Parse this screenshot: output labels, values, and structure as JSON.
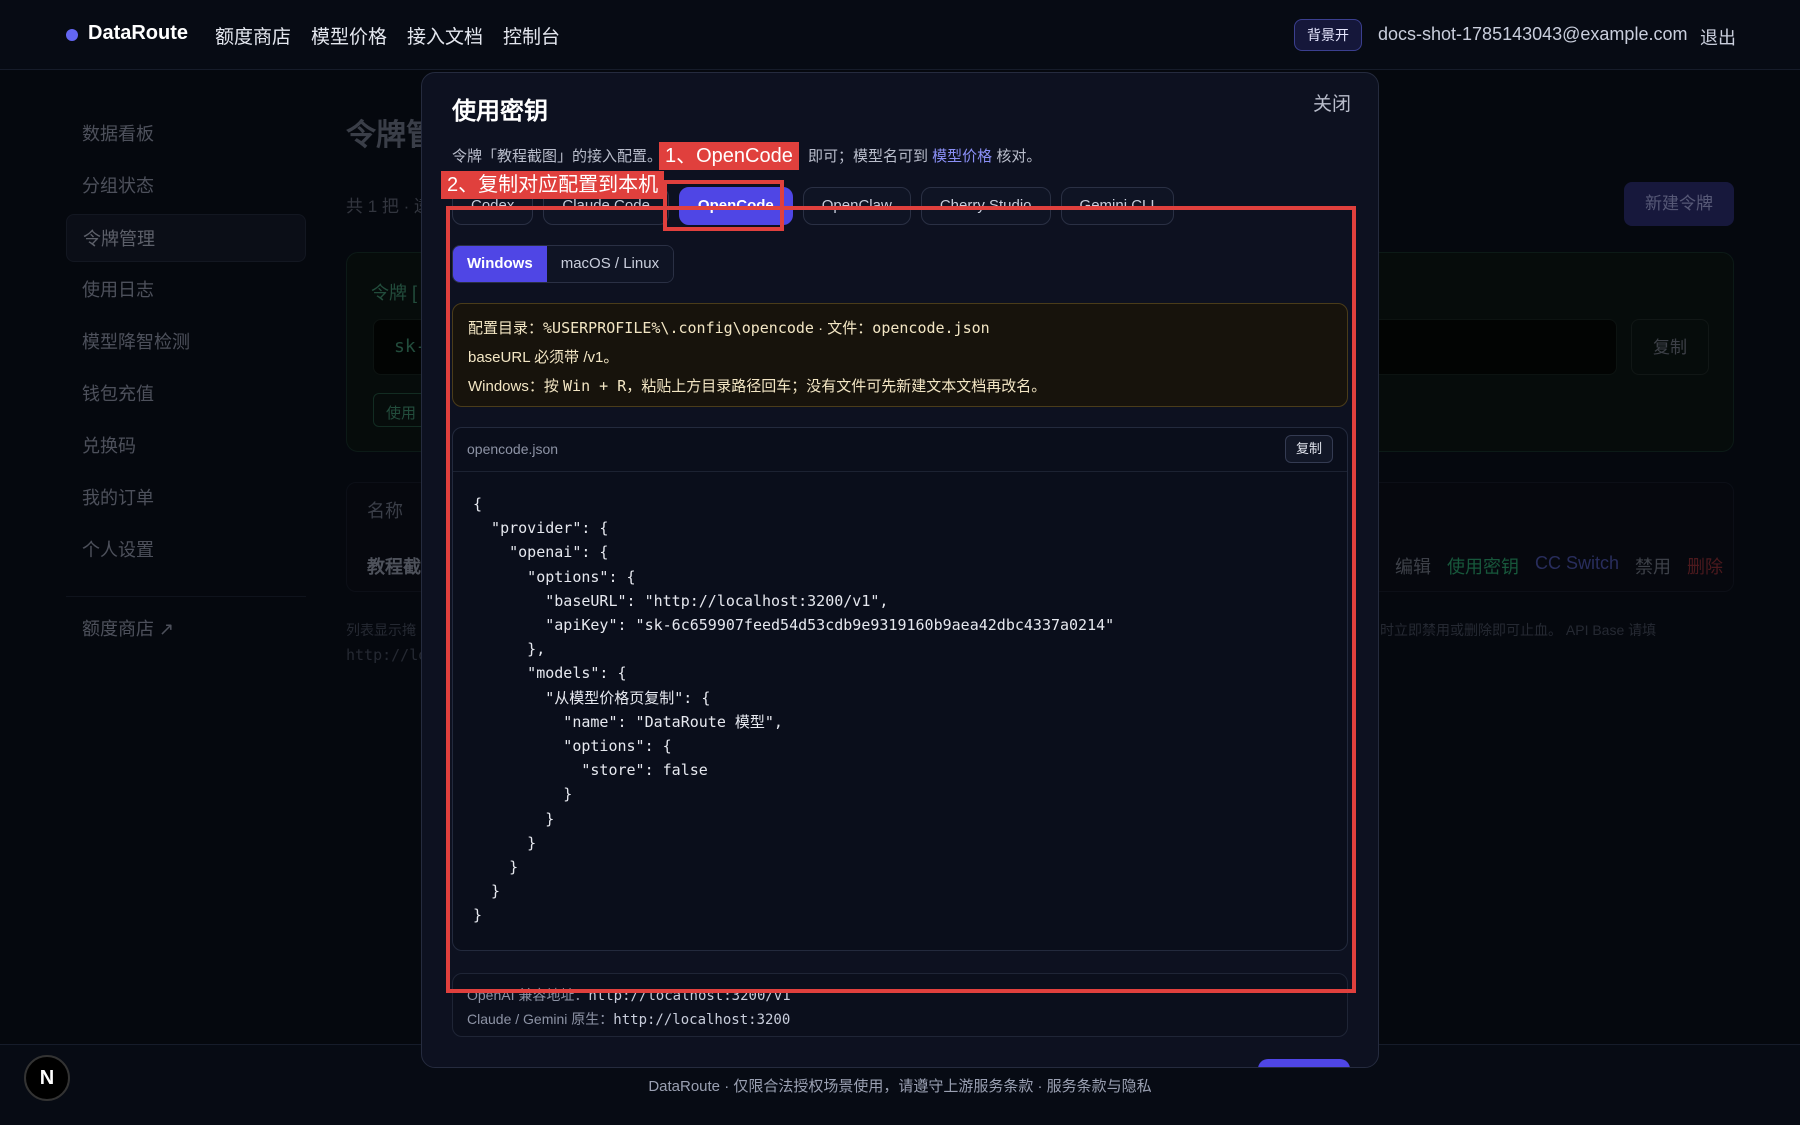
{
  "topbar": {
    "brand": "DataRoute",
    "nav": [
      "额度商店",
      "模型价格",
      "接入文档",
      "控制台"
    ],
    "bg_badge": "背景开",
    "email": "docs-shot-1785143043@example.com",
    "logout": "退出"
  },
  "sidebar": {
    "items": [
      "数据看板",
      "分组状态",
      "令牌管理",
      "使用日志",
      "模型降智检测",
      "钱包充值",
      "兑换码",
      "我的订单",
      "个人设置"
    ],
    "active_index": 2,
    "store_link": "额度商店 ↗"
  },
  "background": {
    "title": "令牌管",
    "subtitle": "共 1 把 · 逮",
    "new_button": "新建令牌",
    "card_label": "令牌 [",
    "key_prefix": "sk-",
    "copy_label": "复制",
    "chip": "使用",
    "table_header": "名称",
    "table_row_name": "教程截",
    "actions": [
      "编辑",
      "使用密钥",
      "CC Switch",
      "禁用",
      "删除"
    ],
    "note_left": "列表显示掩",
    "note_right": "时立即禁用或删除即可止血。 API Base 请填",
    "note_url": "http://lo"
  },
  "modal": {
    "title": "使用密钥",
    "close": "关闭",
    "desc_head": "令牌「教程截图」的接入配置。",
    "desc_tail_a": "即可；模型名可到 ",
    "desc_link": "模型价格",
    "desc_tail_b": " 核对。",
    "tabs": [
      "Codex",
      "Claude Code",
      "OpenCode",
      "OpenClaw",
      "Cherry Studio",
      "Gemini CLI"
    ],
    "active_tab": 2,
    "os_options": [
      "Windows",
      "macOS / Linux"
    ],
    "active_os": 0,
    "info": {
      "dir_label": "配置目录：",
      "dir_value": "%USERPROFILE%\\.config\\opencode",
      "file_label": " · 文件：",
      "file_value": "opencode.json",
      "line2": "baseURL 必须带 /v1。",
      "line3_a": "Windows：按 ",
      "line3_key": "Win + R",
      "line3_b": "，粘贴上方目录路径回车；没有文件可先新建文本文档再改名。"
    },
    "code_file": "opencode.json",
    "code_copy": "复制",
    "code": "{\n  \"provider\": {\n    \"openai\": {\n      \"options\": {\n        \"baseURL\": \"http://localhost:3200/v1\",\n        \"apiKey\": \"sk-6c659907feed54d53cdb9e9319160b9aea42dbc4337a0214\"\n      },\n      \"models\": {\n        \"从模型价格页复制\": {\n          \"name\": \"DataRoute 模型\",\n          \"options\": {\n            \"store\": false\n          }\n        }\n      }\n    }\n  }\n}",
    "openai_base_label": "OpenAI 兼容地址：",
    "openai_base_value": "http://localhost:3200/v1",
    "native_base_label": "Claude / Gemini 原生：",
    "native_base_value": "http://localhost:3200"
  },
  "annotations": {
    "step1": "1、OpenCode",
    "step2": "2、复制对应配置到本机",
    "color": "#e0403d"
  },
  "footer": {
    "text": "DataRoute · 仅限合法授权场景使用，请遵守上游服务条款 · 服务条款与隐私",
    "badge": "N"
  }
}
